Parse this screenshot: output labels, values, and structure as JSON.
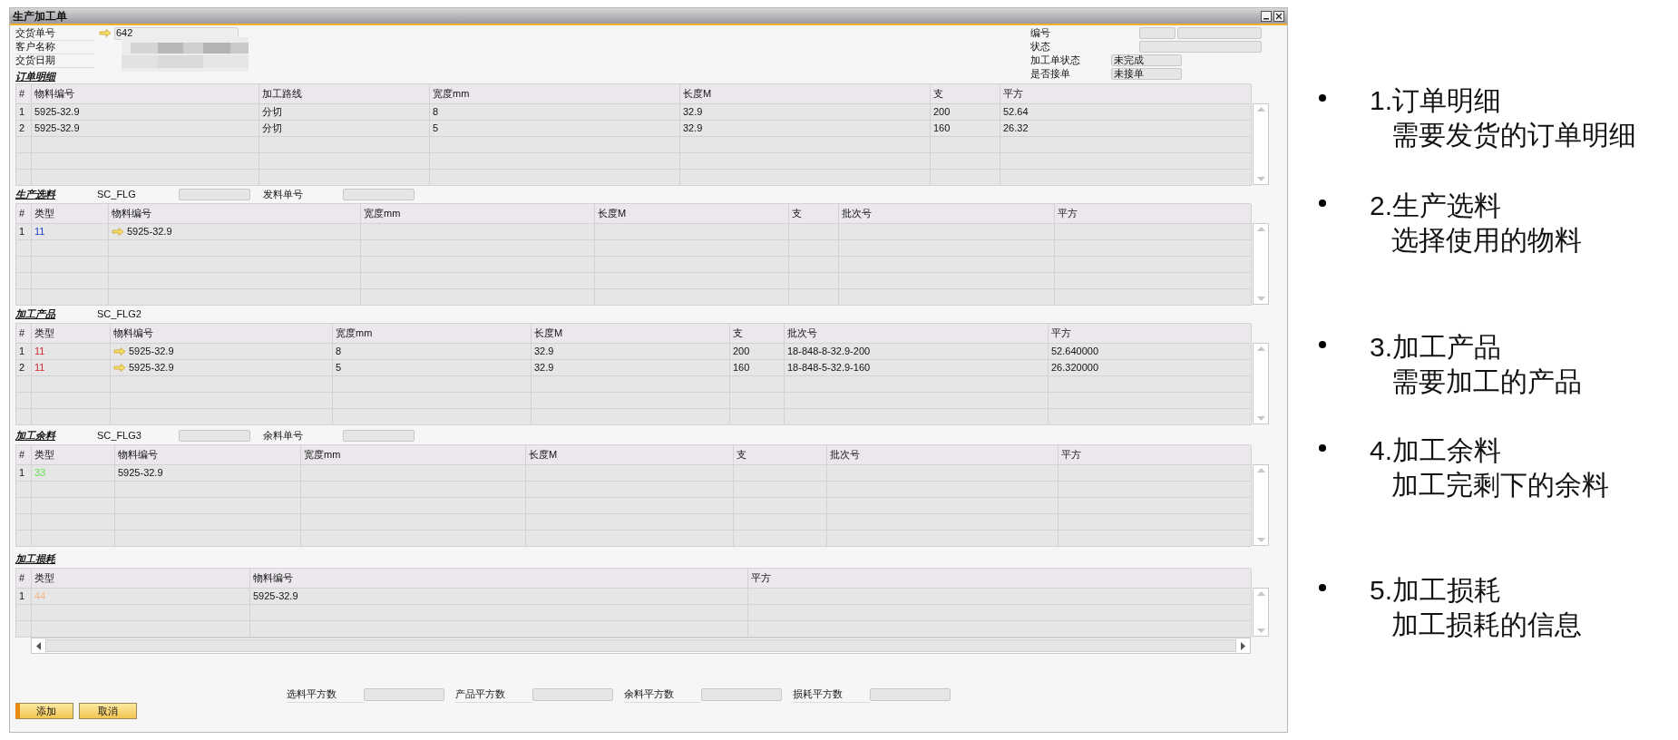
{
  "window": {
    "title": "生产加工单"
  },
  "header_fields": [
    {
      "label": "交货单号",
      "value": "642",
      "link": true
    },
    {
      "label": "客户名称"
    },
    {
      "label": "交货日期"
    }
  ],
  "header_right": [
    {
      "label": "编号",
      "kind": "split"
    },
    {
      "label": "状态",
      "kind": "wide"
    },
    {
      "label": "加工单状态",
      "value": "未完成",
      "kind": "short"
    },
    {
      "label": "是否接单",
      "value": "未接单",
      "kind": "short"
    }
  ],
  "sections": [
    {
      "title": "订单明细",
      "columns": [
        "#",
        "物料编号",
        "加工路线",
        "宽度mm",
        "长度M",
        "支",
        "平方"
      ],
      "rows": [
        {
          "cells": [
            "1",
            "5925-32.9",
            "分切",
            "8",
            "32.9",
            "200",
            "52.64"
          ]
        },
        {
          "cells": [
            "2",
            "5925-32.9",
            "分切",
            "5",
            "32.9",
            "160",
            "26.32"
          ]
        }
      ]
    },
    {
      "title": "生产选料",
      "code": "SC_FLG",
      "doc_label": "发料单号",
      "columns": [
        "#",
        "类型",
        "物料编号",
        "宽度mm",
        "长度M",
        "支",
        "批次号",
        "平方"
      ],
      "rows": [
        {
          "cells": [
            "1",
            {
              "text": "11",
              "color": "#1a3ccc"
            },
            {
              "text": "5925-32.9",
              "link": true
            }
          ]
        }
      ]
    },
    {
      "title": "加工产品",
      "code": "SC_FLG2",
      "columns": [
        "#",
        "类型",
        "物料编号",
        "宽度mm",
        "长度M",
        "支",
        "批次号",
        "平方"
      ],
      "rows": [
        {
          "cells": [
            "1",
            {
              "text": "11",
              "color": "#d02a2a"
            },
            {
              "text": "5925-32.9",
              "link": true
            },
            "8",
            "32.9",
            "200",
            "18-848-8-32.9-200",
            "52.640000"
          ]
        },
        {
          "cells": [
            "2",
            {
              "text": "11",
              "color": "#d02a2a"
            },
            {
              "text": "5925-32.9",
              "link": true
            },
            "5",
            "32.9",
            "160",
            "18-848-5-32.9-160",
            "26.320000"
          ]
        }
      ]
    },
    {
      "title": "加工余料",
      "code": "SC_FLG3",
      "doc_label": "余料单号",
      "columns": [
        "#",
        "类型",
        "物料编号",
        "宽度mm",
        "长度M",
        "支",
        "批次号",
        "平方"
      ],
      "rows": [
        {
          "cells": [
            "1",
            {
              "text": "33",
              "color": "#66dd55"
            },
            "5925-32.9"
          ]
        }
      ]
    },
    {
      "title": "加工损耗",
      "columns": [
        "#",
        "类型",
        "物料编号",
        "平方"
      ],
      "rows": [
        {
          "cells": [
            "1",
            {
              "text": "44",
              "color": "#f0b88c"
            },
            "5925-32.9"
          ]
        }
      ]
    }
  ],
  "totals": [
    {
      "label": "选料平方数"
    },
    {
      "label": "产品平方数"
    },
    {
      "label": "余料平方数"
    },
    {
      "label": "损耗平方数"
    }
  ],
  "buttons": [
    {
      "label": "添加",
      "default": true
    },
    {
      "label": "取消",
      "default": false
    }
  ],
  "annotations": [
    {
      "title": "1.订单明细",
      "detail": "需要发货的订单明细"
    },
    {
      "title": "2.生产选料",
      "detail": "选择使用的物料"
    },
    {
      "title": "3.加工产品",
      "detail": "需要加工的产品"
    },
    {
      "title": "4.加工余料",
      "detail": "加工完剩下的余料"
    },
    {
      "title": "5.加工损耗",
      "detail": "加工损耗的信息"
    }
  ]
}
